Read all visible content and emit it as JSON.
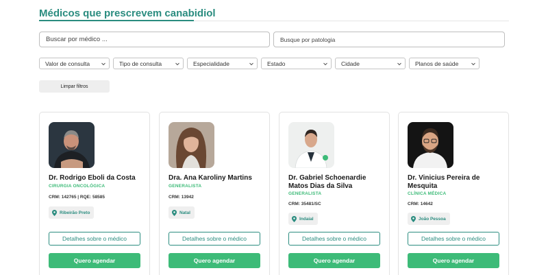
{
  "page": {
    "title": "Médicos que prescrevem canabidiol"
  },
  "search": {
    "doctor_placeholder": "Buscar por médico ...",
    "pathology_placeholder": "Busque por patologia"
  },
  "filters": [
    {
      "label": "Valor de consulta"
    },
    {
      "label": "Tipo de consulta"
    },
    {
      "label": "Especialidade"
    },
    {
      "label": "Estado"
    },
    {
      "label": "Cidade"
    },
    {
      "label": "Planos de saúde"
    }
  ],
  "clear_filters_label": "Limpar filtros",
  "doctors": [
    {
      "name": "Dr. Rodrigo Eboli da Costa",
      "specialty": "CIRURGIA ONCOLÓGICA",
      "crm": "CRM: 142765 | RQE: 58585",
      "city": "Ribeirão Preto",
      "details_label": "Detalhes sobre o médico",
      "book_label": "Quero agendar"
    },
    {
      "name": "Dra. Ana Karoliny Martins",
      "specialty": "GENERALISTA",
      "crm": "CRM: 13942",
      "city": "Natal",
      "details_label": "Detalhes sobre o médico",
      "book_label": "Quero agendar"
    },
    {
      "name": "Dr. Gabriel Schoenardie Matos Dias da Silva",
      "specialty": "GENERALISTA",
      "crm": "CRM: 35481/SC",
      "city": "Indaial",
      "details_label": "Detalhes sobre o médico",
      "book_label": "Quero agendar"
    },
    {
      "name": "Dr. Vinicius Pereira de Mesquita",
      "specialty": "CLÍNICA MÉDICA",
      "crm": "CRM: 14642",
      "city": "João Pessoa",
      "details_label": "Detalhes sobre o médico",
      "book_label": "Quero agendar"
    }
  ],
  "colors": {
    "brand_teal": "#2a8c7f",
    "accent_green": "#3dbb78"
  }
}
